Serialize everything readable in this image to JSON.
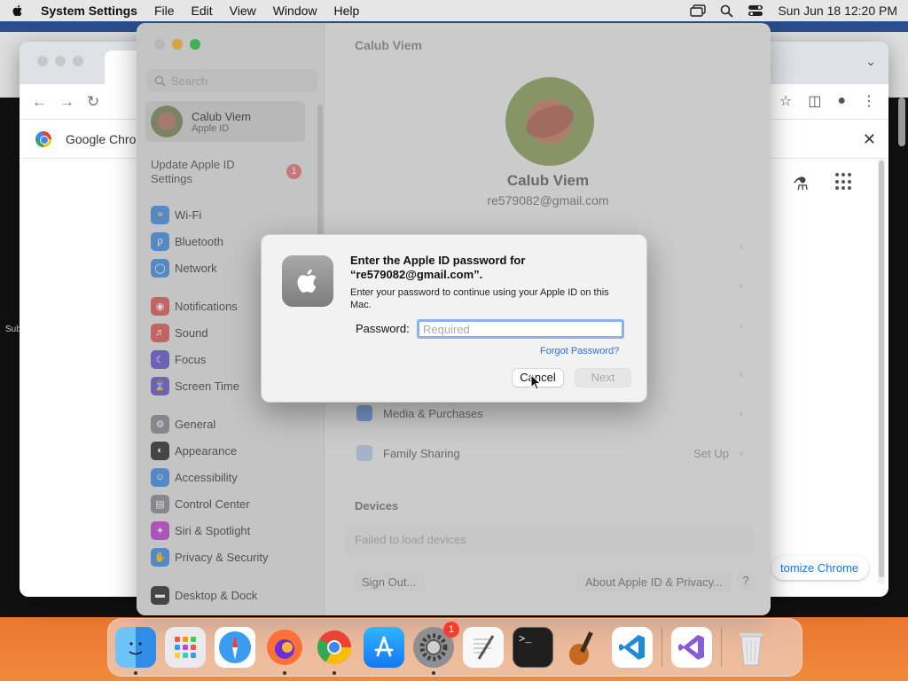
{
  "menubar": {
    "app": "System Settings",
    "menus": [
      "File",
      "Edit",
      "View",
      "Window",
      "Help"
    ],
    "clock": "Sun Jun 18  12:20 PM"
  },
  "chrome": {
    "infobar_text": "Google Chron",
    "customize_label": "tomize Chrome",
    "behind_text": "Sub"
  },
  "settings": {
    "window_title": "Calub Viem",
    "search_placeholder": "Search",
    "user": {
      "name": "Calub Viem",
      "subtitle": "Apple ID"
    },
    "update": {
      "label": "Update Apple ID Settings",
      "badge": "1"
    },
    "sidebar": [
      {
        "label": "Wi-Fi",
        "icon": "wifi-icon",
        "color": "#4a90e2"
      },
      {
        "label": "Bluetooth",
        "icon": "bluetooth-icon",
        "color": "#4a90e2"
      },
      {
        "label": "Network",
        "icon": "globe-icon",
        "color": "#4a90e2"
      },
      {
        "label": "Notifications",
        "icon": "bell-icon",
        "color": "#e25c5c"
      },
      {
        "label": "Sound",
        "icon": "speaker-icon",
        "color": "#e25c5c"
      },
      {
        "label": "Focus",
        "icon": "moon-icon",
        "color": "#6a5acd"
      },
      {
        "label": "Screen Time",
        "icon": "hourglass-icon",
        "color": "#6a5acd"
      },
      {
        "label": "General",
        "icon": "gear-icon",
        "color": "#8e8e93"
      },
      {
        "label": "Appearance",
        "icon": "appearance-icon",
        "color": "#333333"
      },
      {
        "label": "Accessibility",
        "icon": "accessibility-icon",
        "color": "#4a90e2"
      },
      {
        "label": "Control Center",
        "icon": "control-center-icon",
        "color": "#8e8e93"
      },
      {
        "label": "Siri & Spotlight",
        "icon": "siri-icon",
        "color": "#c04ad0"
      },
      {
        "label": "Privacy & Security",
        "icon": "hand-icon",
        "color": "#4a90e2"
      },
      {
        "label": "Desktop & Dock",
        "icon": "dock-icon",
        "color": "#333333"
      }
    ],
    "profile": {
      "name": "Calub Viem",
      "email": "re579082@gmail.com"
    },
    "rows": {
      "media": "Media & Purchases",
      "family": "Family Sharing",
      "family_value": "Set Up"
    },
    "devices_header": "Devices",
    "devices_status": "Failed to load devices",
    "sign_out": "Sign Out...",
    "about": "About Apple ID & Privacy...",
    "help": "?"
  },
  "dialog": {
    "title": "Enter the Apple ID password for “re579082@gmail.com”.",
    "subtitle": "Enter your password to continue using your Apple ID on this Mac.",
    "password_label": "Password:",
    "password_placeholder": "Required",
    "password_value": "",
    "forgot": "Forgot Password?",
    "cancel": "Cancel",
    "next": "Next"
  },
  "dock": {
    "apps": [
      "Finder",
      "Launchpad",
      "Safari",
      "Firefox",
      "Chrome",
      "App Store",
      "System Settings",
      "TextEdit",
      "Terminal",
      "Instruments",
      "VS Code",
      "Visual Studio",
      "Trash"
    ],
    "settings_badge": "1"
  }
}
